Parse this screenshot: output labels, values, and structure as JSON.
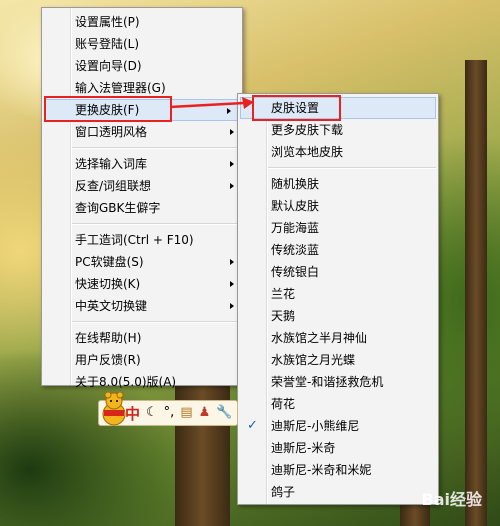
{
  "main_menu": {
    "items": [
      {
        "label": "设置属性(P)"
      },
      {
        "label": "账号登陆(L)"
      },
      {
        "label": "设置向导(D)"
      },
      {
        "label": "输入法管理器(G)"
      },
      {
        "label": "更换皮肤(F)"
      },
      {
        "label": "窗口透明风格"
      },
      {
        "label": "选择输入词库"
      },
      {
        "label": "反查/词组联想"
      },
      {
        "label": "查询GBK生僻字"
      },
      {
        "label": "手工造词(Ctrl + F10)"
      },
      {
        "label": "PC软键盘(S)"
      },
      {
        "label": "快速切换(K)"
      },
      {
        "label": "中英文切换键"
      },
      {
        "label": "在线帮助(H)"
      },
      {
        "label": "用户反馈(R)"
      },
      {
        "label": "关于8.0(5.0)版(A)"
      }
    ]
  },
  "skin_submenu": {
    "items": [
      {
        "label": "皮肤设置"
      },
      {
        "label": "更多皮肤下载"
      },
      {
        "label": "浏览本地皮肤"
      },
      {
        "label": "随机换肤"
      },
      {
        "label": "默认皮肤"
      },
      {
        "label": "万能海蓝"
      },
      {
        "label": "传统淡蓝"
      },
      {
        "label": "传统银白"
      },
      {
        "label": "兰花"
      },
      {
        "label": "天鹅"
      },
      {
        "label": "水族馆之半月神仙"
      },
      {
        "label": "水族馆之月光蝶"
      },
      {
        "label": "荣誉堂-和谐拯救危机"
      },
      {
        "label": "荷花"
      },
      {
        "label": "迪斯尼-小熊维尼"
      },
      {
        "label": "迪斯尼-米奇"
      },
      {
        "label": "迪斯尼-米奇和米妮"
      },
      {
        "label": "鸽子"
      }
    ],
    "checked_mark": "✓"
  },
  "ime_toolbar": {
    "mode_label": "中",
    "icons": [
      "moon-icon",
      "punctuation-icon",
      "keyboard-icon",
      "user-icon",
      "wrench-icon"
    ]
  },
  "watermark": "Bai经验",
  "colors": {
    "highlight_bg": "#dde9f7",
    "annotation_red": "#e8231f",
    "check_blue": "#1d5fb8"
  }
}
